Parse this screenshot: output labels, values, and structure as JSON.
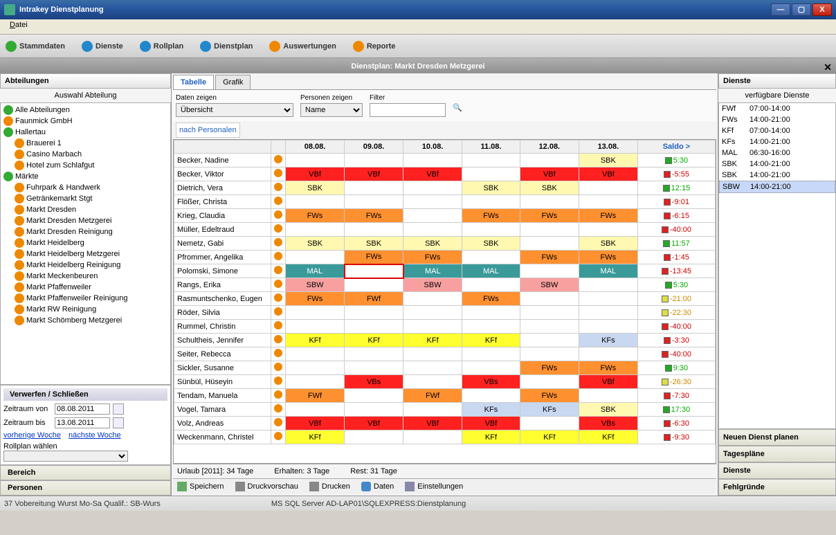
{
  "window": {
    "title": "Intrakey Dienstplanung"
  },
  "menu": {
    "file": "Datei"
  },
  "toolbar": [
    {
      "label": "Stammdaten",
      "icon": "i-green"
    },
    {
      "label": "Dienste",
      "icon": "i-blue"
    },
    {
      "label": "Rollplan",
      "icon": "i-blue"
    },
    {
      "label": "Dienstplan",
      "icon": "i-blue"
    },
    {
      "label": "Auswertungen",
      "icon": "i-orange"
    },
    {
      "label": "Reporte",
      "icon": "i-orange"
    }
  ],
  "page_title": "Dienstplan: Markt Dresden Metzgerei",
  "left": {
    "heading": "Abteilungen",
    "subheading": "Auswahl Abteilung",
    "tree": [
      {
        "l": 0,
        "t": "Alle Abteilungen",
        "c": "i-green"
      },
      {
        "l": 0,
        "t": "Faunmick GmbH",
        "c": "i-orange"
      },
      {
        "l": 0,
        "t": "Hallertau",
        "c": "i-green"
      },
      {
        "l": 1,
        "t": "Brauerei 1",
        "c": "i-orange"
      },
      {
        "l": 1,
        "t": "Casino Marbach",
        "c": "i-orange"
      },
      {
        "l": 1,
        "t": "Hotel zum Schlafgut",
        "c": "i-orange"
      },
      {
        "l": 0,
        "t": "Märkte",
        "c": "i-green"
      },
      {
        "l": 1,
        "t": "Fuhrpark & Handwerk",
        "c": "i-orange"
      },
      {
        "l": 1,
        "t": "Getränkemarkt Stgt",
        "c": "i-orange"
      },
      {
        "l": 1,
        "t": "Markt Dresden",
        "c": "i-orange"
      },
      {
        "l": 1,
        "t": "Markt Dresden Metzgerei",
        "c": "i-orange"
      },
      {
        "l": 1,
        "t": "Markt Dresden Reinigung",
        "c": "i-orange"
      },
      {
        "l": 1,
        "t": "Markt Heidelberg",
        "c": "i-orange"
      },
      {
        "l": 1,
        "t": "Markt Heidelberg Metzgerei",
        "c": "i-orange"
      },
      {
        "l": 1,
        "t": "Markt Heidelberg Reinigung",
        "c": "i-orange"
      },
      {
        "l": 1,
        "t": "Markt Meckenbeuren",
        "c": "i-orange"
      },
      {
        "l": 1,
        "t": "Markt Pfaffenweiler",
        "c": "i-orange"
      },
      {
        "l": 1,
        "t": "Markt Pfaffenweiler Reinigung",
        "c": "i-orange"
      },
      {
        "l": 1,
        "t": "Markt RW Reinigung",
        "c": "i-orange"
      },
      {
        "l": 1,
        "t": "Markt Schömberg Metzgerei",
        "c": "i-orange"
      }
    ],
    "verwerfen": "Verwerfen / Schließen",
    "von_label": "Zeitraum von",
    "von": "08.08.2011",
    "bis_label": "Zeitraum bis",
    "bis": "13.08.2011",
    "prev": "vorherige Woche",
    "next": "nächste Woche",
    "rollplan_label": "Rollplan wählen",
    "bereich": "Bereich",
    "personen": "Personen"
  },
  "center": {
    "tabs": {
      "tabelle": "Tabelle",
      "grafik": "Grafik"
    },
    "filter": {
      "daten_label": "Daten zeigen",
      "daten_value": "Übersicht",
      "personen_label": "Personen zeigen",
      "personen_value": "Name",
      "filter_label": "Filter",
      "filter_value": ""
    },
    "subtab": "nach Personalen",
    "days": [
      "08.08.",
      "09.08.",
      "10.08.",
      "11.08.",
      "12.08.",
      "13.08."
    ],
    "saldo_hdr": "Saldo >",
    "rows": [
      {
        "n": "Becker, Nadine",
        "d": [
          "",
          "",
          "",
          "",
          "",
          "SBK"
        ],
        "s": "5:30",
        "sc": "#0a0"
      },
      {
        "n": "Becker, Viktor",
        "d": [
          "VBf",
          "VBf",
          "VBf",
          "",
          "VBf",
          "VBf"
        ],
        "s": "-5:55",
        "sc": "#c00"
      },
      {
        "n": "Dietrich, Vera",
        "d": [
          "SBK",
          "",
          "",
          "SBK",
          "SBK",
          ""
        ],
        "s": "12:15",
        "sc": "#0a0"
      },
      {
        "n": "Flößer, Christa",
        "d": [
          "",
          "",
          "",
          "",
          "",
          ""
        ],
        "s": "-9:01",
        "sc": "#c00"
      },
      {
        "n": "Krieg, Claudia",
        "d": [
          "FWs",
          "FWs",
          "",
          "FWs",
          "FWs",
          "FWs"
        ],
        "s": "-6:15",
        "sc": "#c00"
      },
      {
        "n": "Müller, Edeltraud",
        "d": [
          "",
          "",
          "",
          "",
          "",
          ""
        ],
        "s": "-40:00",
        "sc": "#c00"
      },
      {
        "n": "Nemetz, Gabi",
        "d": [
          "SBK",
          "SBK",
          "SBK",
          "SBK",
          "",
          "SBK"
        ],
        "s": "11:57",
        "sc": "#0a0"
      },
      {
        "n": "Pfrommer, Angelika",
        "d": [
          "",
          "FWs",
          "FWs",
          "",
          "FWs",
          "FWs"
        ],
        "s": "-1:45",
        "sc": "#c00"
      },
      {
        "n": "Polomski, Simone",
        "d": [
          "MAL",
          "_RED_",
          "MAL",
          "MAL",
          "",
          "MAL"
        ],
        "s": "-13:45",
        "sc": "#c00"
      },
      {
        "n": "Rangs, Erika",
        "d": [
          "SBW",
          "",
          "SBW",
          "",
          "SBW",
          ""
        ],
        "s": "5:30",
        "sc": "#0a0"
      },
      {
        "n": "Rasmuntschenko, Eugen",
        "d": [
          "FWs",
          "FWf",
          "",
          "FWs",
          "",
          ""
        ],
        "s": "-21:00",
        "sc": "#c80"
      },
      {
        "n": "Röder, Silvia",
        "d": [
          "",
          "",
          "",
          "",
          "",
          ""
        ],
        "s": "-22:30",
        "sc": "#c80"
      },
      {
        "n": "Rummel, Christin",
        "d": [
          "",
          "",
          "",
          "",
          "",
          ""
        ],
        "s": "-40:00",
        "sc": "#c00"
      },
      {
        "n": "Schultheis, Jennifer",
        "d": [
          "KFf",
          "KFf",
          "KFf",
          "KFf",
          "",
          "KFs"
        ],
        "s": "-3:30",
        "sc": "#c00"
      },
      {
        "n": "Seiter, Rebecca",
        "d": [
          "",
          "",
          "",
          "",
          "",
          ""
        ],
        "s": "-40:00",
        "sc": "#c00"
      },
      {
        "n": "Sickler, Susanne",
        "d": [
          "",
          "",
          "",
          "",
          "FWs",
          "FWs"
        ],
        "s": "9:30",
        "sc": "#0a0"
      },
      {
        "n": "Sünbül, Hüseyin",
        "d": [
          "",
          "VBs",
          "",
          "VBs",
          "",
          "VBf"
        ],
        "s": "-26:30",
        "sc": "#c80"
      },
      {
        "n": "Tendam, Manuela",
        "d": [
          "FWf",
          "",
          "FWf",
          "",
          "FWs",
          ""
        ],
        "s": "-7:30",
        "sc": "#c00"
      },
      {
        "n": "Vogel, Tamara",
        "d": [
          "",
          "",
          "",
          "KFs",
          "KFs",
          "SBK"
        ],
        "s": "17:30",
        "sc": "#0a0"
      },
      {
        "n": "Volz, Andreas",
        "d": [
          "VBf",
          "VBf",
          "VBf",
          "VBf",
          "",
          "VBs"
        ],
        "s": "-6:30",
        "sc": "#c00"
      },
      {
        "n": "Weckenmann, Christel",
        "d": [
          "KFf",
          "",
          "",
          "KFf",
          "KFf",
          "KFf"
        ],
        "s": "-9:30",
        "sc": "#c00"
      }
    ],
    "urlaub": {
      "total": "Urlaub [2011]: 34 Tage",
      "erhalten": "Erhalten: 3 Tage",
      "rest": "Rest: 31 Tage"
    },
    "buttons": {
      "speichern": "Speichern",
      "druckvorschau": "Druckvorschau",
      "drucken": "Drucken",
      "daten": "Daten",
      "einstellungen": "Einstellungen"
    }
  },
  "right": {
    "heading": "Dienste",
    "sub": "verfügbare Dienste",
    "items": [
      {
        "c": "FWf",
        "t": "07:00-14:00"
      },
      {
        "c": "FWs",
        "t": "14:00-21:00"
      },
      {
        "c": "KFf",
        "t": "07:00-14:00"
      },
      {
        "c": "KFs",
        "t": "14:00-21:00"
      },
      {
        "c": "MAL",
        "t": "06:30-16:00"
      },
      {
        "c": "SBK",
        "t": "14:00-21:00"
      },
      {
        "c": "SBK",
        "t": "14:00-21:00"
      },
      {
        "c": "SBW",
        "t": "14:00-21:00",
        "sel": true
      }
    ],
    "neu": "Neuen Dienst planen",
    "tagesplane": "Tagespläne",
    "dienste": "Dienste",
    "fehlgruende": "Fehlgründe"
  },
  "status": {
    "left": "37 Vobereitung Wurst  Mo-Sa  Qualif.: SB-Wurs",
    "center": "MS SQL Server AD-LAP01\\SQLEXPRESS:Dienstplanung"
  }
}
